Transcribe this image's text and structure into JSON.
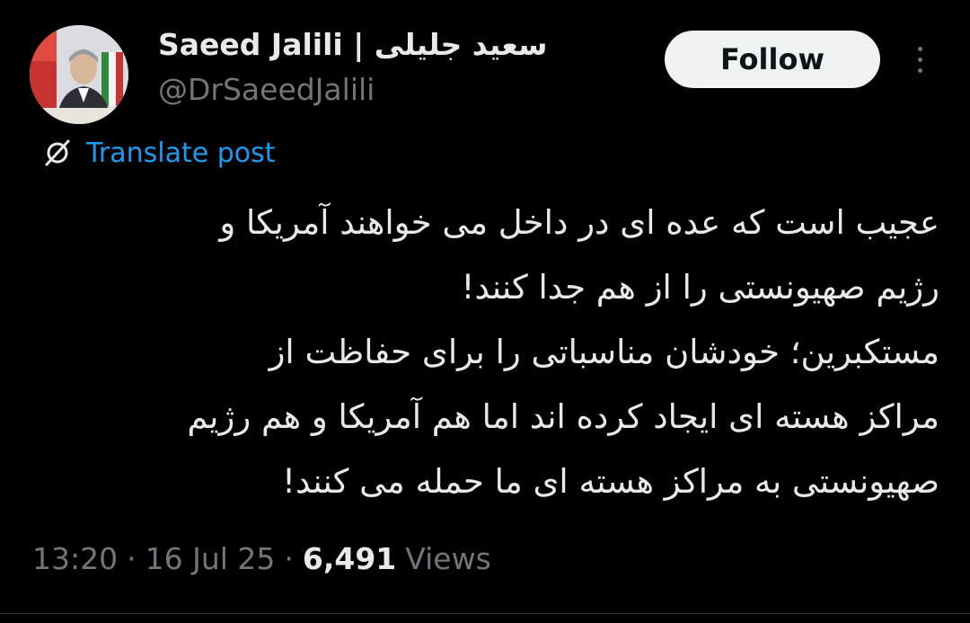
{
  "author": {
    "display_name": "Saeed Jalili | سعید جلیلی",
    "handle": "@DrSaeedJalili"
  },
  "header": {
    "follow_label": "Follow",
    "more_icon": "more-vertical-icon"
  },
  "translate": {
    "icon": "globe-slash-icon",
    "label": "Translate post"
  },
  "tweet": {
    "lines": [
      "عجیب است که عده ای در داخل می خواهند آمریکا و",
      "رژیم صهیونستی را از هم جدا کنند!",
      "مستکبرین؛ خودشان مناسباتی را برای حفاظت از",
      "مراکز هسته ای ایجاد کرده اند اما هم آمریکا و هم رژیم",
      "صهیونستی به مراکز هسته ای ما حمله می کنند!"
    ]
  },
  "meta": {
    "time": "13:20",
    "separator": "·",
    "date": "16 Jul 25",
    "views_count": "6,491",
    "views_label": "Views"
  },
  "colors": {
    "background": "#000000",
    "text_primary": "#e7e9ea",
    "text_secondary": "#71767b",
    "link": "#1d9bf0",
    "follow_bg": "#eff3f4"
  }
}
